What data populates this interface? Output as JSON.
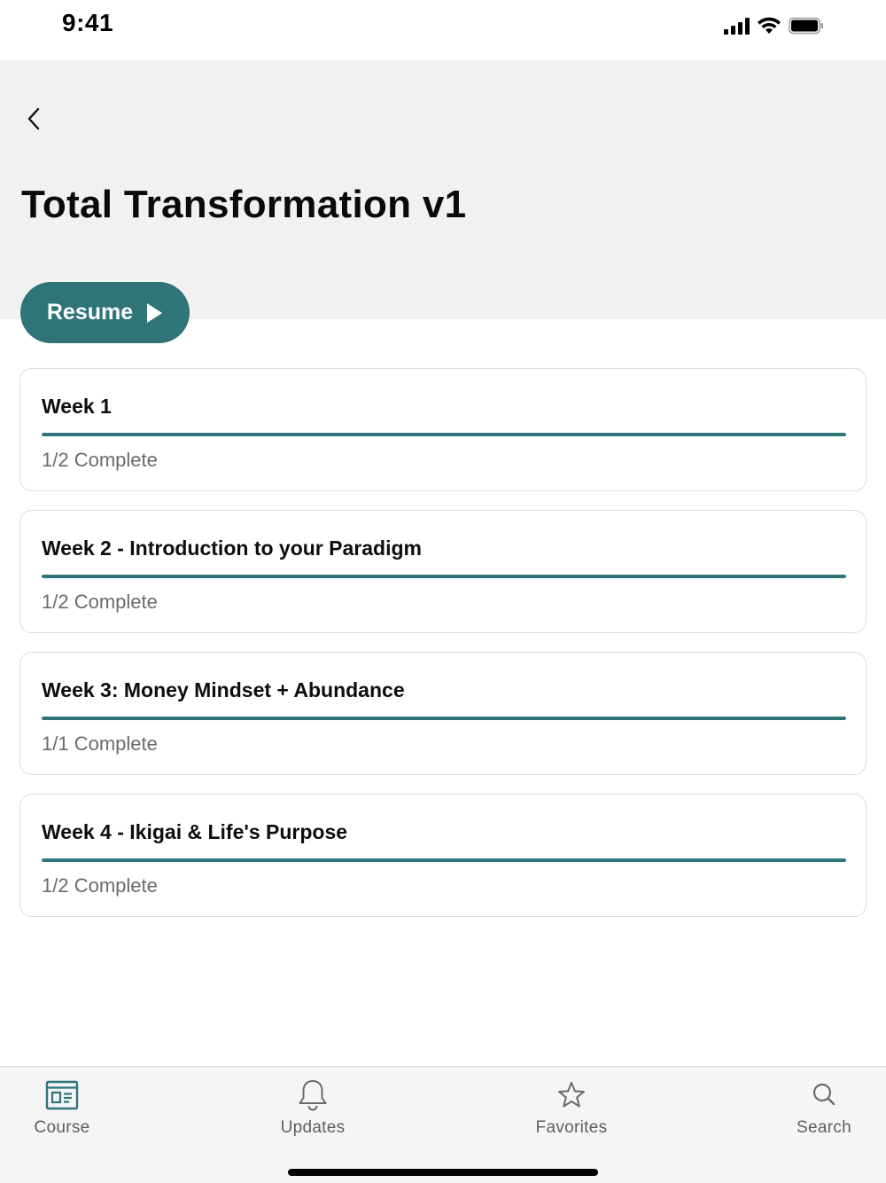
{
  "status_bar": {
    "time": "9:41"
  },
  "header": {
    "title": "Total Transformation v1",
    "back_icon": "chevron-left-icon"
  },
  "resume": {
    "label": "Resume",
    "icon": "play-icon"
  },
  "weeks": [
    {
      "title": "Week 1",
      "status": "1/2 Complete",
      "progress": 1.0
    },
    {
      "title": "Week 2 - Introduction to your Paradigm",
      "status": "1/2 Complete",
      "progress": 1.0
    },
    {
      "title": "Week 3: Money Mindset + Abundance",
      "status": "1/1 Complete",
      "progress": 1.0
    },
    {
      "title": "Week 4 - Ikigai & Life's Purpose",
      "status": "1/2 Complete",
      "progress": 1.0
    }
  ],
  "tabs": [
    {
      "label": "Course",
      "icon": "course-icon",
      "active": true
    },
    {
      "label": "Updates",
      "icon": "bell-icon",
      "active": false
    },
    {
      "label": "Favorites",
      "icon": "star-icon",
      "active": false
    },
    {
      "label": "Search",
      "icon": "search-icon",
      "active": false
    }
  ],
  "colors": {
    "accent": "#2e7479",
    "header_bg": "#f1f1f1",
    "card_border": "#dcdcdc",
    "muted_text": "#6b6b6b"
  }
}
